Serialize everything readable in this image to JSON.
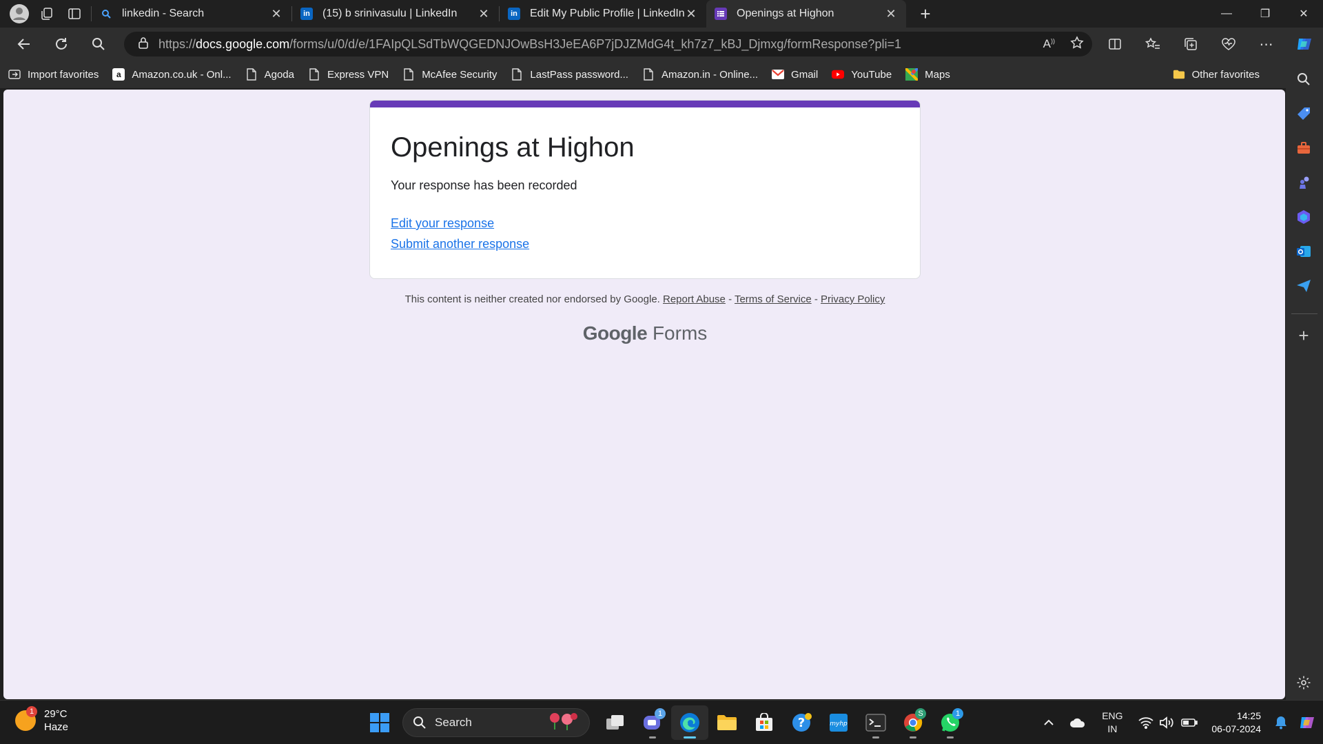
{
  "tabs": [
    {
      "title": "linkedin - Search",
      "icon": "search-icon",
      "active": false
    },
    {
      "title": "(15) b srinivasulu | LinkedIn",
      "icon": "linkedin-icon",
      "active": false
    },
    {
      "title": "Edit My Public Profile | LinkedIn",
      "icon": "linkedin-icon",
      "active": false
    },
    {
      "title": "Openings at Highon",
      "icon": "google-forms-icon",
      "active": true
    }
  ],
  "address": {
    "url_prefix": "https://",
    "url_domain": "docs.google.com",
    "url_path": "/forms/u/0/d/e/1FAIpQLSdTbWQGEDNJOwBsH3JeEA6P7jDJZMdG4t_kh7z7_kBJ_Djmxg/formResponse?pli=1"
  },
  "favorites": [
    {
      "label": "Import favorites",
      "icon": "import-icon"
    },
    {
      "label": "Amazon.co.uk - Onl...",
      "icon": "amazon-icon"
    },
    {
      "label": "Agoda",
      "icon": "page-icon"
    },
    {
      "label": "Express VPN",
      "icon": "page-icon"
    },
    {
      "label": "McAfee Security",
      "icon": "page-icon"
    },
    {
      "label": "LastPass password...",
      "icon": "page-icon"
    },
    {
      "label": "Amazon.in - Online...",
      "icon": "page-icon"
    },
    {
      "label": "Gmail",
      "icon": "gmail-icon"
    },
    {
      "label": "YouTube",
      "icon": "youtube-icon"
    },
    {
      "label": "Maps",
      "icon": "maps-icon"
    }
  ],
  "other_favorites": "Other favorites",
  "form": {
    "title": "Openings at Highon",
    "message": "Your response has been recorded",
    "edit_link": "Edit your response",
    "another_link": "Submit another response",
    "accent_color": "#673ab7"
  },
  "footer": {
    "note": "This content is neither created nor endorsed by Google.",
    "report": "Report Abuse",
    "sep1": " - ",
    "terms": "Terms of Service",
    "sep2": " - ",
    "privacy": "Privacy Policy",
    "brand_google": "Google",
    "brand_forms": " Forms"
  },
  "taskbar": {
    "weather_temp": "29°C",
    "weather_desc": "Haze",
    "weather_badge": "1",
    "search_placeholder": "Search",
    "teams_badge": "1",
    "chrome_badge": "S",
    "whatsapp_badge": "1",
    "lang_top": "ENG",
    "lang_bottom": "IN",
    "time": "14:25",
    "date": "06-07-2024"
  }
}
